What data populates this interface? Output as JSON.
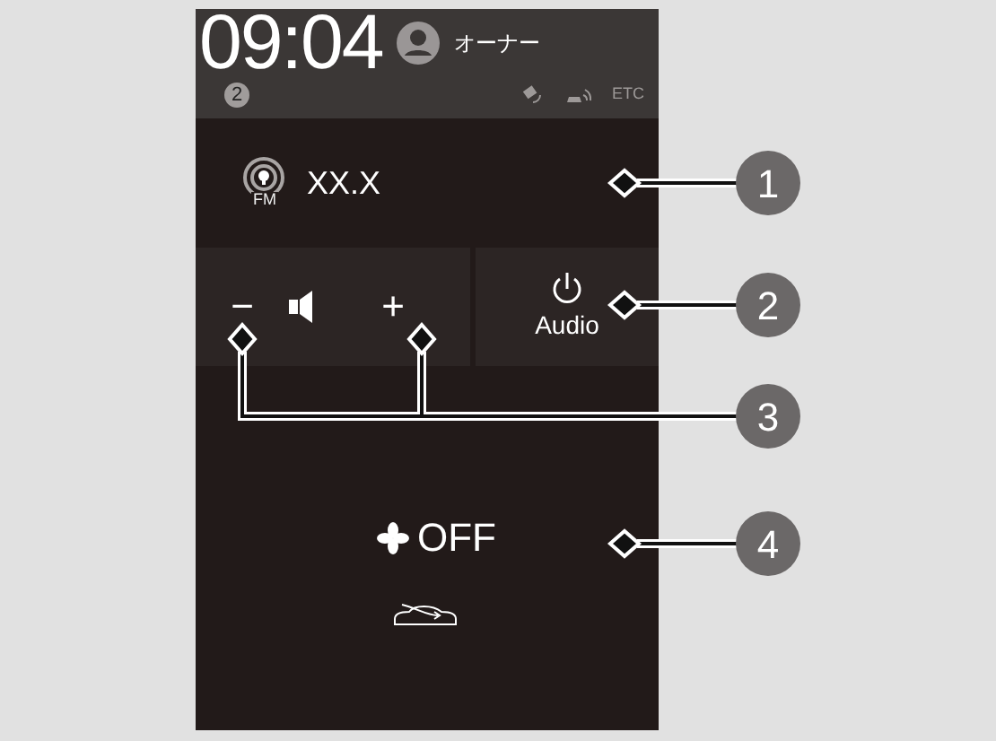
{
  "status_bar": {
    "time": "09:04",
    "user": "オーナー",
    "badge": "2",
    "etc": "ETC"
  },
  "radio": {
    "band": "FM",
    "station": "XX.X"
  },
  "volume": {
    "minus": "−",
    "plus": "+"
  },
  "audio_button": {
    "label": "Audio"
  },
  "climate": {
    "fan": "OFF"
  },
  "callouts": [
    "1",
    "2",
    "3",
    "4"
  ]
}
